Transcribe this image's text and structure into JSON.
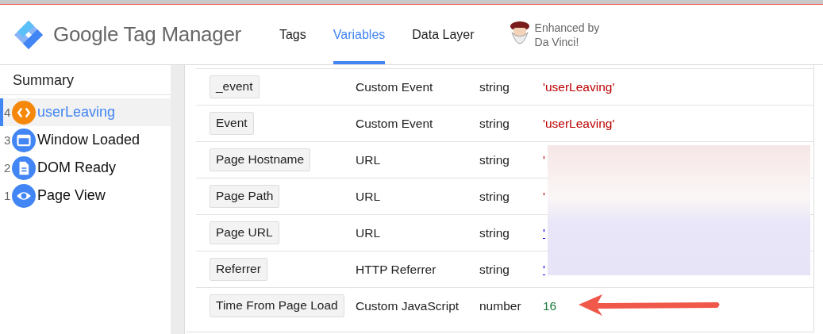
{
  "header": {
    "product": "Google Tag Manager",
    "tabs": [
      {
        "label": "Tags",
        "selected": false
      },
      {
        "label": "Variables",
        "selected": true
      },
      {
        "label": "Data Layer",
        "selected": false
      }
    ],
    "badge": {
      "line1": "Enhanced by",
      "line2": "Da Vinci!"
    }
  },
  "sidebar": {
    "title": "Summary",
    "events": [
      {
        "number": "4",
        "label": "userLeaving",
        "kind": "code",
        "selected": true
      },
      {
        "number": "3",
        "label": "Window Loaded",
        "kind": "window",
        "selected": false
      },
      {
        "number": "2",
        "label": "DOM Ready",
        "kind": "document",
        "selected": false
      },
      {
        "number": "1",
        "label": "Page View",
        "kind": "eye",
        "selected": false
      }
    ]
  },
  "variables": [
    {
      "name": "_event",
      "type": "Custom Event",
      "data_type": "string",
      "value": "'userLeaving'",
      "kind": "string"
    },
    {
      "name": "Event",
      "type": "Custom Event",
      "data_type": "string",
      "value": "'userLeaving'",
      "kind": "string"
    },
    {
      "name": "Page Hostname",
      "type": "URL",
      "data_type": "string",
      "value": "'",
      "kind": "string"
    },
    {
      "name": "Page Path",
      "type": "URL",
      "data_type": "string",
      "value": "'",
      "kind": "string"
    },
    {
      "name": "Page URL",
      "type": "URL",
      "data_type": "string",
      "value": "'",
      "kind": "link"
    },
    {
      "name": "Referrer",
      "type": "HTTP Referrer",
      "data_type": "string",
      "value": "'",
      "kind": "link"
    },
    {
      "name": "Time From Page Load",
      "type": "Custom JavaScript",
      "data_type": "number",
      "value": "16",
      "kind": "number"
    }
  ]
}
